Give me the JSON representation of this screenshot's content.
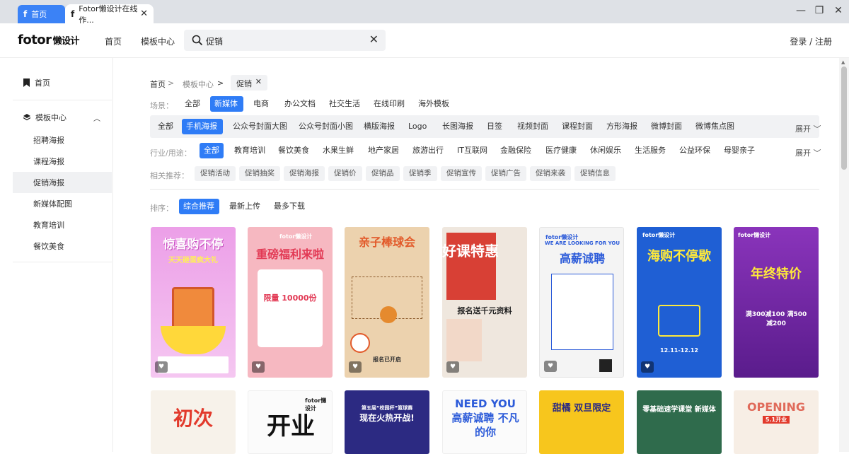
{
  "browser": {
    "tabs": [
      {
        "label": "首页",
        "favicon": "f"
      },
      {
        "label": "Fotor懒设计在线作...",
        "favicon": "f"
      }
    ],
    "close_glyph": "✕",
    "win_min": "—",
    "win_max": "❐",
    "win_close": "✕"
  },
  "header": {
    "logo": "fotor",
    "logo_sub": "懒设计",
    "nav": [
      "首页",
      "模板中心"
    ],
    "search_value": "促销",
    "clear_glyph": "✕",
    "login": "登录 / 注册"
  },
  "sidebar": {
    "home": "首页",
    "template_center": "模板中心",
    "items": [
      "招聘海报",
      "课程海报",
      "促销海报",
      "新媒体配图",
      "教育培训",
      "餐饮美食"
    ],
    "active_index": 2
  },
  "breadcrumb": {
    "items": [
      "首页",
      "模板中心"
    ],
    "tag": "促销",
    "sep": ">",
    "tag_close": "✕"
  },
  "scene": {
    "label": "场景：",
    "options": [
      "全部",
      "新媒体",
      "电商",
      "办公文档",
      "社交生活",
      "在线印刷",
      "海外模板"
    ],
    "selected": "新媒体"
  },
  "category": {
    "options": [
      "全部",
      "手机海报",
      "公众号封面大图",
      "公众号封面小图",
      "横版海报",
      "Logo",
      "长图海报",
      "日签",
      "视频封面",
      "课程封面",
      "方形海报",
      "微博封面",
      "微博焦点图"
    ],
    "selected": "手机海报",
    "expand": "展开"
  },
  "industry": {
    "label": "行业/用途：",
    "options": [
      "全部",
      "教育培训",
      "餐饮美食",
      "水果生鲜",
      "地产家居",
      "旅游出行",
      "IT互联网",
      "金融保险",
      "医疗健康",
      "休闲娱乐",
      "生活服务",
      "公益环保",
      "母婴亲子"
    ],
    "selected": "全部",
    "expand": "展开"
  },
  "related": {
    "label": "相关推荐：",
    "tags": [
      "促销活动",
      "促销抽奖",
      "促销海报",
      "促销价",
      "促销品",
      "促销季",
      "促销宣传",
      "促销广告",
      "促销来袭",
      "促销信息"
    ]
  },
  "sort": {
    "label": "排序：",
    "options": [
      "综合推荐",
      "最新上传",
      "最多下载"
    ],
    "selected": "综合推荐"
  },
  "cards_row1": [
    {
      "title": "惊喜购不停",
      "sub": "天天砸蛋疯大礼",
      "bg": "#e9a4e6"
    },
    {
      "title": "重磅福利来啦",
      "sub": "限量 10000份",
      "bg": "#f6b8c1"
    },
    {
      "title": "亲子棒球会",
      "sub": "报名已开启",
      "bg": "#ecd2ae"
    },
    {
      "title": "好课特惠",
      "sub": "报名送千元资料",
      "bg": "#efe7de"
    },
    {
      "title": "高薪诚聘",
      "sub": "WE ARE LOOKING FOR YOU",
      "bg": "#f4f4f4"
    },
    {
      "title": "海购不停歇",
      "sub": "12.11-12.12",
      "bg": "#1f5fd4"
    },
    {
      "title": "年终特价",
      "sub": "满300减100 满500减200",
      "bg": "#7a2aa8"
    }
  ],
  "cards_row2": [
    {
      "title": "初次",
      "bg": "#f7f2ea"
    },
    {
      "title": "开业",
      "bg": "#fbfbfb"
    },
    {
      "title": "现在火热开战!",
      "sub": "第五届“校园杯”篮球赛",
      "bg": "#2c2a82"
    },
    {
      "title": "NEED YOU 高薪诚聘 不凡的你",
      "bg": "#fbfbfb"
    },
    {
      "title": "甜橘 双旦限定",
      "bg": "#f7c61d"
    },
    {
      "title": "零基础速学课堂 新媒体",
      "bg": "#2f6b4c"
    },
    {
      "title": "OPENING",
      "sub": "5.1开业",
      "bg": "#f7eee5"
    }
  ],
  "card_brand": "fotor懒设计"
}
